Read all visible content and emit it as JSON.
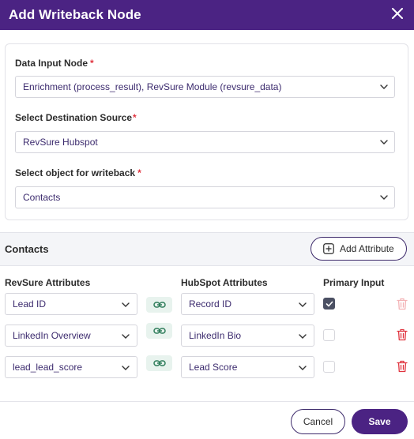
{
  "dialog": {
    "title": "Add Writeback Node",
    "close_icon": "close-icon"
  },
  "form": {
    "data_input": {
      "label": "Data Input Node",
      "required_mark": "*",
      "value": "Enrichment (process_result), RevSure Module (revsure_data)"
    },
    "destination": {
      "label": "Select Destination Source",
      "required_mark": "*",
      "value": "RevSure Hubspot"
    },
    "object": {
      "label": "Select object for writeback",
      "required_mark": "*",
      "value": "Contacts"
    }
  },
  "mapping": {
    "section_title": "Contacts",
    "add_attribute_label": "Add Attribute",
    "columns": {
      "revsure": "RevSure Attributes",
      "hubspot": "HubSpot Attributes",
      "primary": "Primary Input"
    },
    "rows": [
      {
        "revsure": "Lead ID",
        "hubspot": "Record ID",
        "primary": true,
        "delete_enabled": false
      },
      {
        "revsure": "LinkedIn Overview",
        "hubspot": "LinkedIn Bio",
        "primary": false,
        "delete_enabled": true
      },
      {
        "revsure": "lead_lead_score",
        "hubspot": "Lead Score",
        "primary": false,
        "delete_enabled": true
      }
    ]
  },
  "footer": {
    "cancel_label": "Cancel",
    "save_label": "Save"
  },
  "colors": {
    "brand": "#4b2383",
    "danger": "#e0343f",
    "danger_disabled": "#f3b3b6",
    "link_bg": "#e8f3ee",
    "link_icon": "#2f7d5b"
  }
}
